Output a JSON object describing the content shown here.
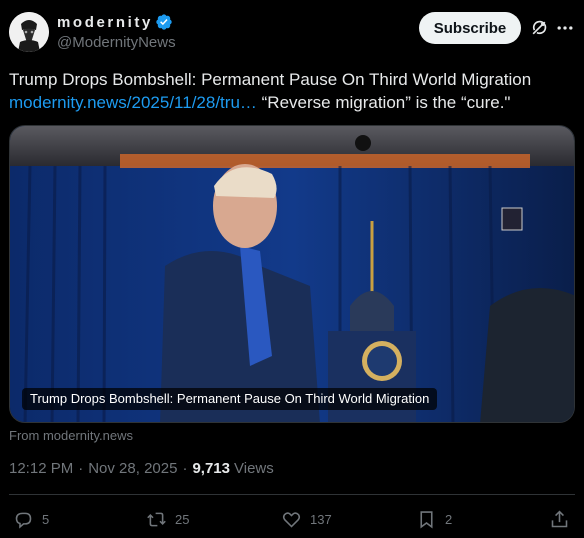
{
  "author": {
    "display_name": "modernity",
    "handle": "@ModernityNews",
    "avatar_icon": "plague-doctor-icon",
    "verified_icon": "verified-badge-icon"
  },
  "header": {
    "subscribe_label": "Subscribe",
    "grok_icon": "grok-icon",
    "more_icon": "more-icon"
  },
  "tweet": {
    "headline": "Trump Drops Bombshell: Permanent Pause On Third World Migration",
    "link_text": "modernity.news/2025/11/28/tru…",
    "tail_text": " “Reverse migration” is the “cure.\""
  },
  "card": {
    "caption": "Trump Drops Bombshell: Permanent Pause On Third World Migration",
    "source": "From modernity.news"
  },
  "meta": {
    "time": "12:12 PM",
    "separator": "·",
    "date": "Nov 28, 2025",
    "views_count": "9,713",
    "views_label": "Views"
  },
  "actions": {
    "replies": "5",
    "reposts": "25",
    "likes": "137",
    "bookmarks": "2"
  },
  "colors": {
    "background": "#000000",
    "link": "#1d9bf0",
    "muted": "#71767b",
    "text": "#e7e9ea",
    "verified": "#1d9bf0"
  }
}
